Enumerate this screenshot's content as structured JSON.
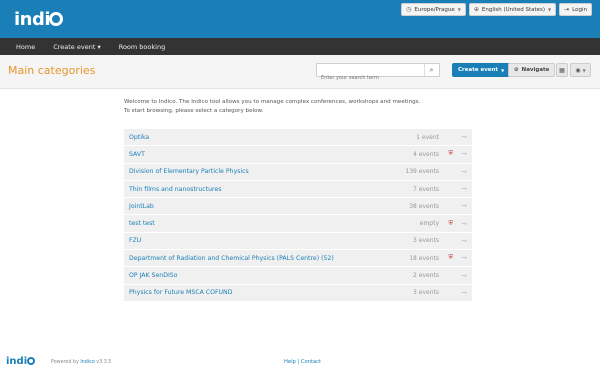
{
  "header": {
    "logo_text": "indi",
    "timezone": "Europe/Prague",
    "language": "English (United States)",
    "login": "Login"
  },
  "nav": {
    "items": [
      {
        "label": "Home"
      },
      {
        "label": "Create event ▾"
      },
      {
        "label": "Room booking"
      }
    ]
  },
  "titlebar": {
    "title": "Main categories",
    "search_placeholder": "Enter your search term",
    "create_event": "Create event",
    "navigate": "Navigate"
  },
  "welcome": {
    "line1": "Welcome to Indico. The Indico tool allows you to manage complex conferences, workshops and meetings.",
    "line2": "To start browsing, please select a category below."
  },
  "categories": [
    {
      "name": "Optika",
      "count": "1 event",
      "protected": false
    },
    {
      "name": "SAVT",
      "count": "4 events",
      "protected": true
    },
    {
      "name": "Division of Elementary Particle Physics",
      "count": "139 events",
      "protected": false
    },
    {
      "name": "Thin films and nanostructures",
      "count": "7 events",
      "protected": false
    },
    {
      "name": "JointLab",
      "count": "38 events",
      "protected": false
    },
    {
      "name": "test test",
      "count": "empty",
      "protected": true
    },
    {
      "name": "FZU",
      "count": "3 events",
      "protected": false
    },
    {
      "name": "Department of Radiation and Chemical Physics (PALS Centre) (52)",
      "count": "18 events",
      "protected": true
    },
    {
      "name": "OP JAK SenDISo",
      "count": "2 events",
      "protected": false
    },
    {
      "name": "Physics for Future MSCA COFUND",
      "count": "3 events",
      "protected": false
    }
  ],
  "footer": {
    "logo_text": "indi",
    "powered_prefix": "Powered by",
    "powered_link": "Indico",
    "version": "v3.3.5",
    "links": "Help | Contact"
  },
  "colors": {
    "brand": "#1a7fb7",
    "title_orange": "#e5962a",
    "navbar": "#333333"
  }
}
